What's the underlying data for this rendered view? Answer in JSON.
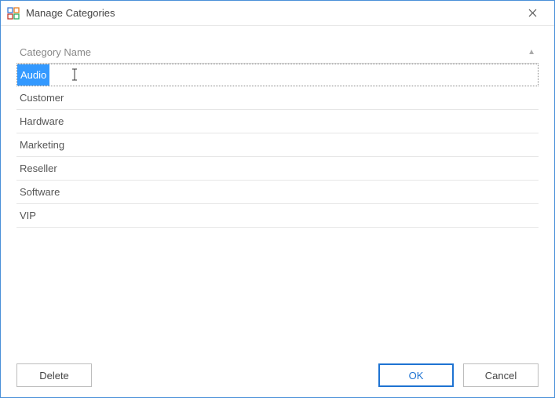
{
  "window": {
    "title": "Manage Categories"
  },
  "header": {
    "column_label": "Category Name",
    "sort_icon": "▲"
  },
  "editing": {
    "value": "Audio"
  },
  "rows": [
    {
      "label": "Customer"
    },
    {
      "label": "Hardware"
    },
    {
      "label": "Marketing"
    },
    {
      "label": "Reseller"
    },
    {
      "label": "Software"
    },
    {
      "label": "VIP"
    }
  ],
  "buttons": {
    "delete": "Delete",
    "ok": "OK",
    "cancel": "Cancel"
  }
}
